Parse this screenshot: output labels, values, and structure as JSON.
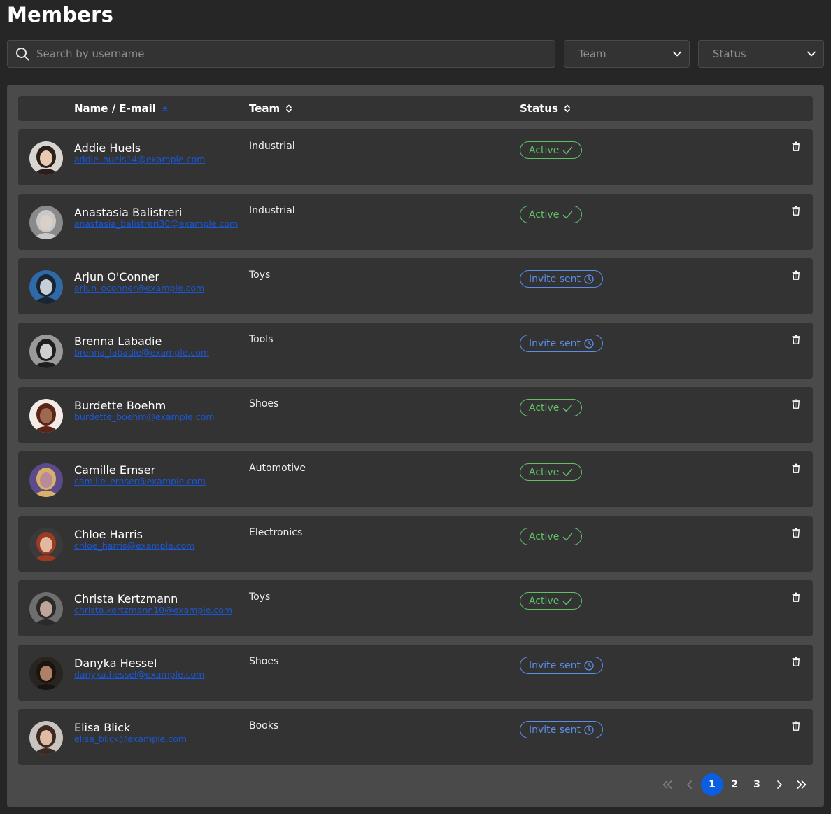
{
  "page": {
    "title": "Members"
  },
  "search": {
    "placeholder": "Search by username",
    "icon": "search-icon"
  },
  "filters": {
    "team_placeholder": "Team",
    "status_placeholder": "Status"
  },
  "table": {
    "columns": {
      "name": "Name / E-mail",
      "team": "Team",
      "status": "Status"
    },
    "rows": [
      {
        "name": "Addie Huels",
        "email": "addie_huels14@example.com",
        "team": "Industrial",
        "status": "Active",
        "status_type": "active",
        "avatar": {
          "bg": "#d8d4d0",
          "hair": "#2a1f1a",
          "skin": "#e8c9b2"
        }
      },
      {
        "name": "Anastasia Balistreri",
        "email": "anastasia_balistreri30@example.com",
        "team": "Industrial",
        "status": "Active",
        "status_type": "active",
        "avatar": {
          "bg": "#8a8a8a",
          "hair": "#c9c9c9",
          "skin": "#d9d0c8"
        }
      },
      {
        "name": "Arjun O'Conner",
        "email": "arjun_oconner@example.com",
        "team": "Toys",
        "status": "Invite sent",
        "status_type": "invite",
        "avatar": {
          "bg": "#2f6aa8",
          "hair": "#1a2530",
          "skin": "#c7ced6"
        }
      },
      {
        "name": "Brenna Labadie",
        "email": "brenna_labadie@example.com",
        "team": "Tools",
        "status": "Invite sent",
        "status_type": "invite",
        "avatar": {
          "bg": "#9a9a9a",
          "hair": "#1e1e1e",
          "skin": "#cfcfcf"
        }
      },
      {
        "name": "Burdette Boehm",
        "email": "burdette_boehm@example.com",
        "team": "Shoes",
        "status": "Active",
        "status_type": "active",
        "avatar": {
          "bg": "#f3ece6",
          "hair": "#5a2418",
          "skin": "#9e6a4f"
        }
      },
      {
        "name": "Camille Ernser",
        "email": "camille_ernser@example.com",
        "team": "Automotive",
        "status": "Active",
        "status_type": "active",
        "avatar": {
          "bg": "#5b4b8a",
          "hair": "#d9b06a",
          "skin": "#b88a9a"
        }
      },
      {
        "name": "Chloe Harris",
        "email": "chloe_harris@example.com",
        "team": "Electronics",
        "status": "Active",
        "status_type": "active",
        "avatar": {
          "bg": "#3a3a3a",
          "hair": "#9c3a22",
          "skin": "#e2b8a0"
        }
      },
      {
        "name": "Christa Kertzmann",
        "email": "christa.kertzmann10@example.com",
        "team": "Toys",
        "status": "Active",
        "status_type": "active",
        "avatar": {
          "bg": "#6e6e6e",
          "hair": "#2a2a2a",
          "skin": "#bfa49a"
        }
      },
      {
        "name": "Danyka Hessel",
        "email": "danyka.hessel@example.com",
        "team": "Shoes",
        "status": "Invite sent",
        "status_type": "invite",
        "avatar": {
          "bg": "#2a2420",
          "hair": "#1a1410",
          "skin": "#b08066"
        }
      },
      {
        "name": "Elisa Blick",
        "email": "elisa_blick@example.com",
        "team": "Books",
        "status": "Invite sent",
        "status_type": "invite",
        "avatar": {
          "bg": "#c9c4bf",
          "hair": "#3a2a22",
          "skin": "#e0bca4"
        }
      }
    ]
  },
  "pagination": {
    "pages": [
      "1",
      "2",
      "3"
    ],
    "current": "1"
  },
  "colors": {
    "active": "#5ec265",
    "invite": "#5b8ee8",
    "link": "#1a57d6",
    "accent": "#0b5ee0"
  }
}
